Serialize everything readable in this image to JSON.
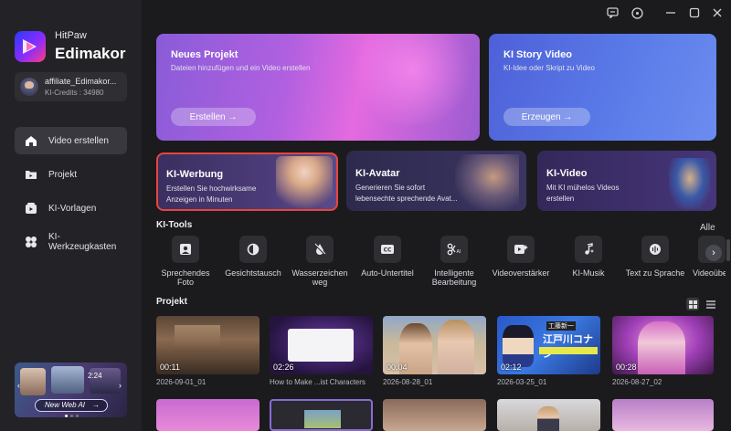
{
  "app": {
    "brand_top": "HitPaw",
    "brand_main": "Edimakor"
  },
  "account": {
    "name": "affiliate_Edimakor...",
    "credits": "KI-Credits : 34980"
  },
  "nav": [
    {
      "label": "Video erstellen",
      "icon": "home-icon"
    },
    {
      "label": "Projekt",
      "icon": "folder-icon"
    },
    {
      "label": "KI-Vorlagen",
      "icon": "template-icon"
    },
    {
      "label": "KI-Werkzeugkasten",
      "icon": "toolbox-icon"
    }
  ],
  "promo": {
    "text": "New Web AI",
    "small": "2:24"
  },
  "cards": {
    "new_project": {
      "title": "Neues Projekt",
      "sub": "Dateien hinzufügen und ein Video erstellen",
      "button": "Erstellen →"
    },
    "story": {
      "title": "KI Story Video",
      "sub": "KI-Idee oder Skript zu Video",
      "button": "Erzeugen →"
    },
    "werbung": {
      "title": "KI-Werbung",
      "sub1": "Erstellen Sie hochwirksame",
      "sub2": "Anzeigen in Minuten"
    },
    "avatar": {
      "title": "KI-Avatar",
      "sub1": "Generieren Sie sofort",
      "sub2": "lebensechte sprechende Avat..."
    },
    "video": {
      "title": "KI-Video",
      "sub1": "Mit KI mühelos Videos",
      "sub2": "erstellen"
    }
  },
  "tools_section": {
    "title": "KI-Tools",
    "all": "Alle"
  },
  "tools": [
    {
      "l1": "Sprechendes",
      "l2": "Foto"
    },
    {
      "l1": "Gesichtstausch",
      "l2": ""
    },
    {
      "l1": "Wasserzeichen",
      "l2": "weg"
    },
    {
      "l1": "Auto-Untertitel",
      "l2": ""
    },
    {
      "l1": "Intelligente",
      "l2": "Bearbeitung"
    },
    {
      "l1": "Videoverstärker",
      "l2": ""
    },
    {
      "l1": "KI-Musik",
      "l2": ""
    },
    {
      "l1": "Text zu Sprache",
      "l2": ""
    },
    {
      "l1": "Videoüber",
      "l2": ""
    }
  ],
  "projects_section": {
    "title": "Projekt"
  },
  "projects": [
    {
      "dur": "00:11",
      "name": "2026-09-01_01"
    },
    {
      "dur": "02:26",
      "name": "How to Make ...ist Characters"
    },
    {
      "dur": "00:04",
      "name": "2026-08-28_01"
    },
    {
      "dur": "02:12",
      "name": "2026-03-25_01"
    },
    {
      "dur": "00:28",
      "name": "2026-08-27_02"
    }
  ],
  "thumb_texts": {
    "anime": "江戸川コナン",
    "anime_top": "工藤新一"
  }
}
